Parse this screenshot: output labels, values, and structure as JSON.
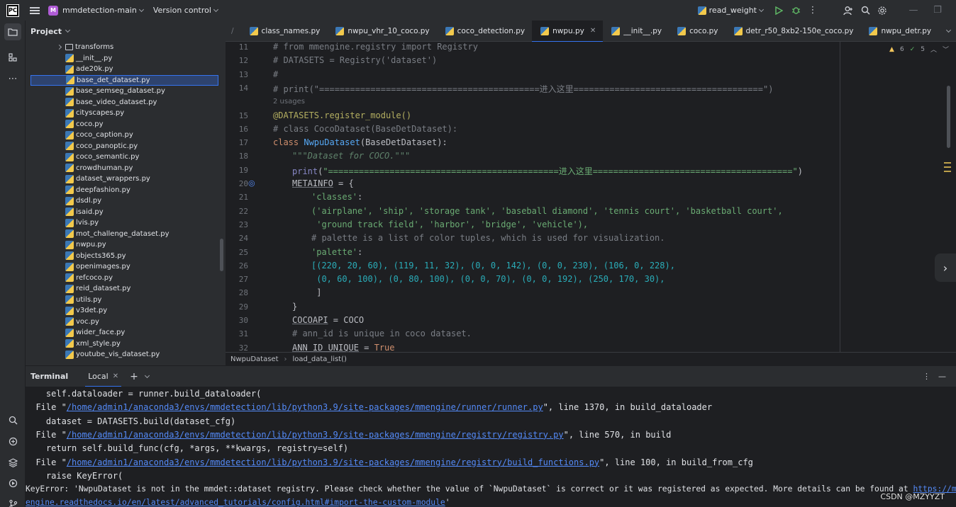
{
  "titlebar": {
    "logo": "PC",
    "project_badge": "M",
    "project_name": "mmdetection-main",
    "vcs": "Version control",
    "run_config": "read_weight"
  },
  "project_panel": {
    "title": "Project",
    "items": [
      {
        "label": "transforms",
        "type": "folder"
      },
      {
        "label": "__init__.py",
        "type": "py"
      },
      {
        "label": "ade20k.py",
        "type": "py"
      },
      {
        "label": "base_det_dataset.py",
        "type": "py",
        "selected": true
      },
      {
        "label": "base_semseg_dataset.py",
        "type": "py"
      },
      {
        "label": "base_video_dataset.py",
        "type": "py"
      },
      {
        "label": "cityscapes.py",
        "type": "py"
      },
      {
        "label": "coco.py",
        "type": "py"
      },
      {
        "label": "coco_caption.py",
        "type": "py"
      },
      {
        "label": "coco_panoptic.py",
        "type": "py"
      },
      {
        "label": "coco_semantic.py",
        "type": "py"
      },
      {
        "label": "crowdhuman.py",
        "type": "py"
      },
      {
        "label": "dataset_wrappers.py",
        "type": "py"
      },
      {
        "label": "deepfashion.py",
        "type": "py"
      },
      {
        "label": "dsdl.py",
        "type": "py"
      },
      {
        "label": "isaid.py",
        "type": "py"
      },
      {
        "label": "lvis.py",
        "type": "py"
      },
      {
        "label": "mot_challenge_dataset.py",
        "type": "py"
      },
      {
        "label": "nwpu.py",
        "type": "py"
      },
      {
        "label": "objects365.py",
        "type": "py"
      },
      {
        "label": "openimages.py",
        "type": "py"
      },
      {
        "label": "refcoco.py",
        "type": "py"
      },
      {
        "label": "reid_dataset.py",
        "type": "py"
      },
      {
        "label": "utils.py",
        "type": "py"
      },
      {
        "label": "v3det.py",
        "type": "py"
      },
      {
        "label": "voc.py",
        "type": "py"
      },
      {
        "label": "wider_face.py",
        "type": "py"
      },
      {
        "label": "xml_style.py",
        "type": "py"
      },
      {
        "label": "youtube_vis_dataset.py",
        "type": "py"
      }
    ]
  },
  "tabs": [
    {
      "label": "class_names.py"
    },
    {
      "label": "nwpu_vhr_10_coco.py"
    },
    {
      "label": "coco_detection.py"
    },
    {
      "label": "nwpu.py",
      "active": true
    },
    {
      "label": "__init__.py"
    },
    {
      "label": "coco.py"
    },
    {
      "label": "detr_r50_8xb2-150e_coco.py"
    },
    {
      "label": "nwpu_detr.py"
    }
  ],
  "editor": {
    "inspections": {
      "warnings": "6",
      "ok": "5"
    },
    "usages": "2 usages",
    "line_numbers": [
      "11",
      "12",
      "13",
      "14",
      "15",
      "16",
      "17",
      "18",
      "19",
      "20",
      "21",
      "22",
      "23",
      "24",
      "25",
      "26",
      "27",
      "28",
      "29",
      "30",
      "31",
      "32"
    ],
    "lines": {
      "l11": "# from mmengine.registry import Registry",
      "l12": "# DATASETS = Registry('dataset')",
      "l13": "#",
      "l14": "# print(\"===========================================进入这里=====================================\")",
      "l15": "@DATASETS.register_module()",
      "l16": "# class CocoDataset(BaseDetDataset):",
      "l17_kw": "class ",
      "l17_name": "NwpuDataset",
      "l17_rest": "(BaseDetDataset):",
      "l18": "\"\"\"Dataset for COCO.\"\"\"",
      "l19_fn": "print",
      "l19_str": "\"=============================================进入这里=======================================\"",
      "l20_id": "METAINFO",
      "l20_rest": " = {",
      "l21": "'classes'",
      "l22": "('airplane', 'ship', 'storage tank', 'baseball diamond', 'tennis court', 'basketball court',",
      "l23": " 'ground track field', 'harbor', 'bridge', 'vehicle'),",
      "l24": "# palette is a list of color tuples, which is used for visualization.",
      "l25": "'palette'",
      "l26": "[(220, 20, 60), (119, 11, 32), (0, 0, 142), (0, 0, 230), (106, 0, 228),",
      "l27": " (0, 60, 100), (0, 80, 100), (0, 0, 70), (0, 0, 192), (250, 170, 30),",
      "l28": " ]",
      "l29": "}",
      "l30_id": "COCOAPI",
      "l30_rest": " = COCO",
      "l31": "# ann_id is unique in coco dataset.",
      "l32_id": "ANN_ID_UNIQUE",
      "l32_rest": " = ",
      "l32_val": "True"
    }
  },
  "breadcrumb": {
    "class": "NwpuDataset",
    "method": "load_data_list()"
  },
  "terminal": {
    "title": "Terminal",
    "tab": "Local",
    "lines": {
      "t1": "    self.dataloader = runner.build_dataloader(",
      "t2_pre": "  File \"",
      "t2_link": "/home/admin1/anaconda3/envs/mmdetection/lib/python3.9/site-packages/mmengine/runner/runner.py",
      "t2_post": "\", line 1370, in build_dataloader",
      "t3": "    dataset = DATASETS.build(dataset_cfg)",
      "t4_pre": "  File \"",
      "t4_link": "/home/admin1/anaconda3/envs/mmdetection/lib/python3.9/site-packages/mmengine/registry/registry.py",
      "t4_post": "\", line 570, in build",
      "t5": "    return self.build_func(cfg, *args, **kwargs, registry=self)",
      "t6_pre": "  File \"",
      "t6_link": "/home/admin1/anaconda3/envs/mmdetection/lib/python3.9/site-packages/mmengine/registry/build_functions.py",
      "t6_post": "\", line 100, in build_from_cfg",
      "t7": "    raise KeyError(",
      "t8_pre": "KeyError: 'NwpuDataset is not in the mmdet::dataset registry. Please check whether the value of `NwpuDataset` is correct or it was registered as expected. More details can be found at ",
      "t8_link": "https://mm",
      "t9_link": "engine.readthedocs.io/en/latest/advanced_tutorials/config.html#import-the-custom-module",
      "t9_post": "'"
    }
  },
  "watermark": "CSDN @MZYYZT"
}
